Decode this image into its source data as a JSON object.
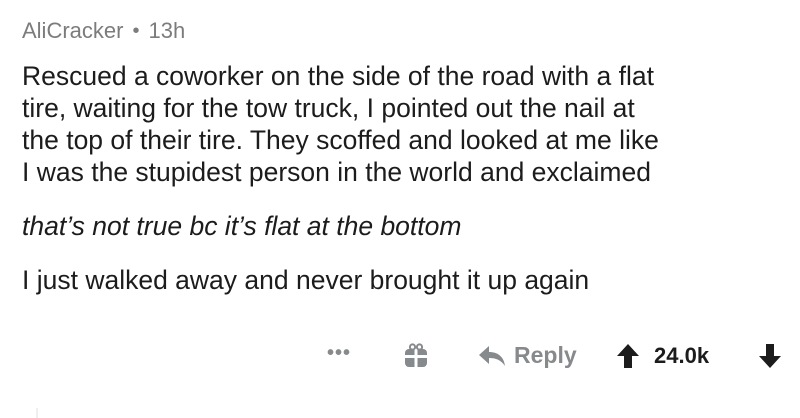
{
  "comment": {
    "author": "AliCracker",
    "separator": "•",
    "age": "13h",
    "paragraphs": [
      "Rescued a coworker on the side of the road with a flat\ntire, waiting for the tow truck, I pointed out the nail at\nthe top of their tire.  They scoffed and looked at me like\nI was the stupidest person in the world and exclaimed",
      "that’s not true bc it’s flat at the bottom",
      "I just walked away and never brought it up again"
    ],
    "actions": {
      "more_label": "•••",
      "reply_label": "Reply",
      "score": "24.0k"
    }
  },
  "icons": {
    "award": "gift-award-icon",
    "reply": "reply-arrow-icon",
    "upvote": "upvote-arrow-icon",
    "downvote": "downvote-arrow-icon"
  },
  "colors": {
    "meta_text": "#7c7c7c",
    "body_text": "#1c1c1c",
    "action_gray": "#878a8c",
    "vote_dark": "#1c1c1c"
  }
}
